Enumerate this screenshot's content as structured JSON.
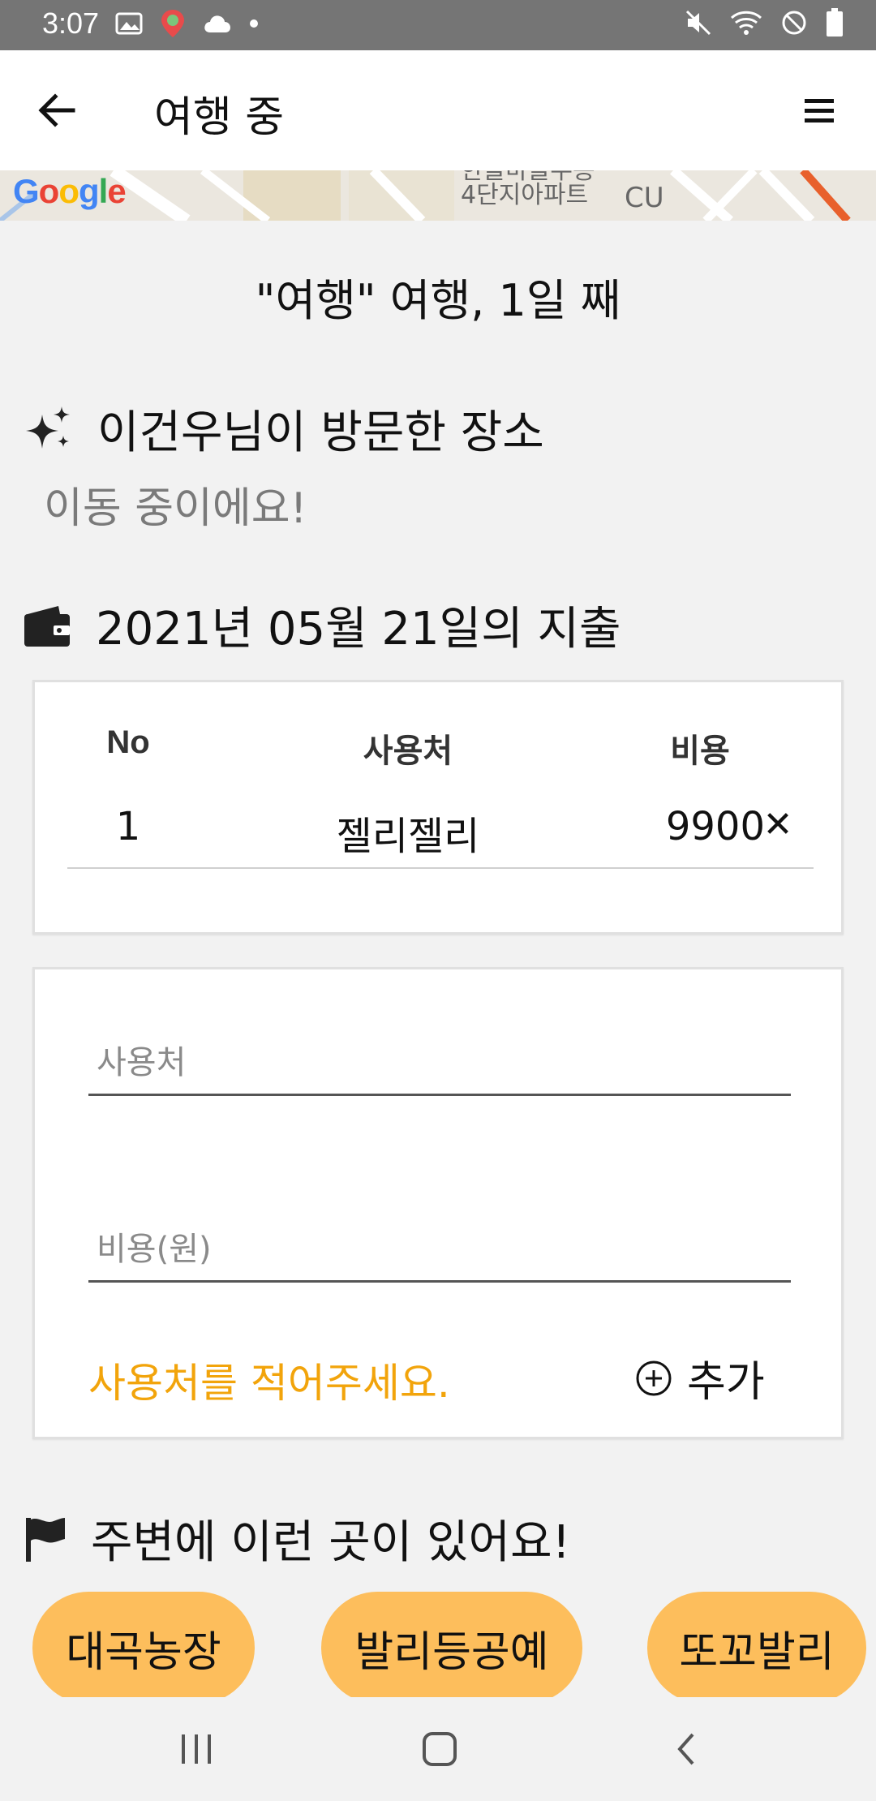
{
  "status_bar": {
    "time": "3:07"
  },
  "app_bar": {
    "title": "여행 중"
  },
  "map": {
    "google": "Google",
    "text_line1": "한들마을우봉",
    "text_line2": "4단지아파트",
    "store": "CU"
  },
  "trip_subtitle": "\"여행\" 여행, 1일 째",
  "visited": {
    "heading": "이건우님이 방문한 장소",
    "status": "이동 중이에요!"
  },
  "expense": {
    "heading": "2021년 05월 21일의 지출",
    "columns": [
      "No",
      "사용처",
      "비용"
    ],
    "rows": [
      {
        "no": "1",
        "place": "젤리젤리",
        "cost": "9900"
      }
    ],
    "delete_symbol": "✕"
  },
  "form": {
    "place_placeholder": "사용처",
    "cost_placeholder": "비용(원)",
    "warning": "사용처를 적어주세요.",
    "add_label": "추가"
  },
  "nearby": {
    "heading": "주변에 이런 곳이 있어요!",
    "places": [
      "대곡농장",
      "발리등공예",
      "또꼬발리"
    ]
  },
  "colors": {
    "accent": "#fdbe5c",
    "warning": "#f2a40b",
    "status_bar": "#757575"
  }
}
